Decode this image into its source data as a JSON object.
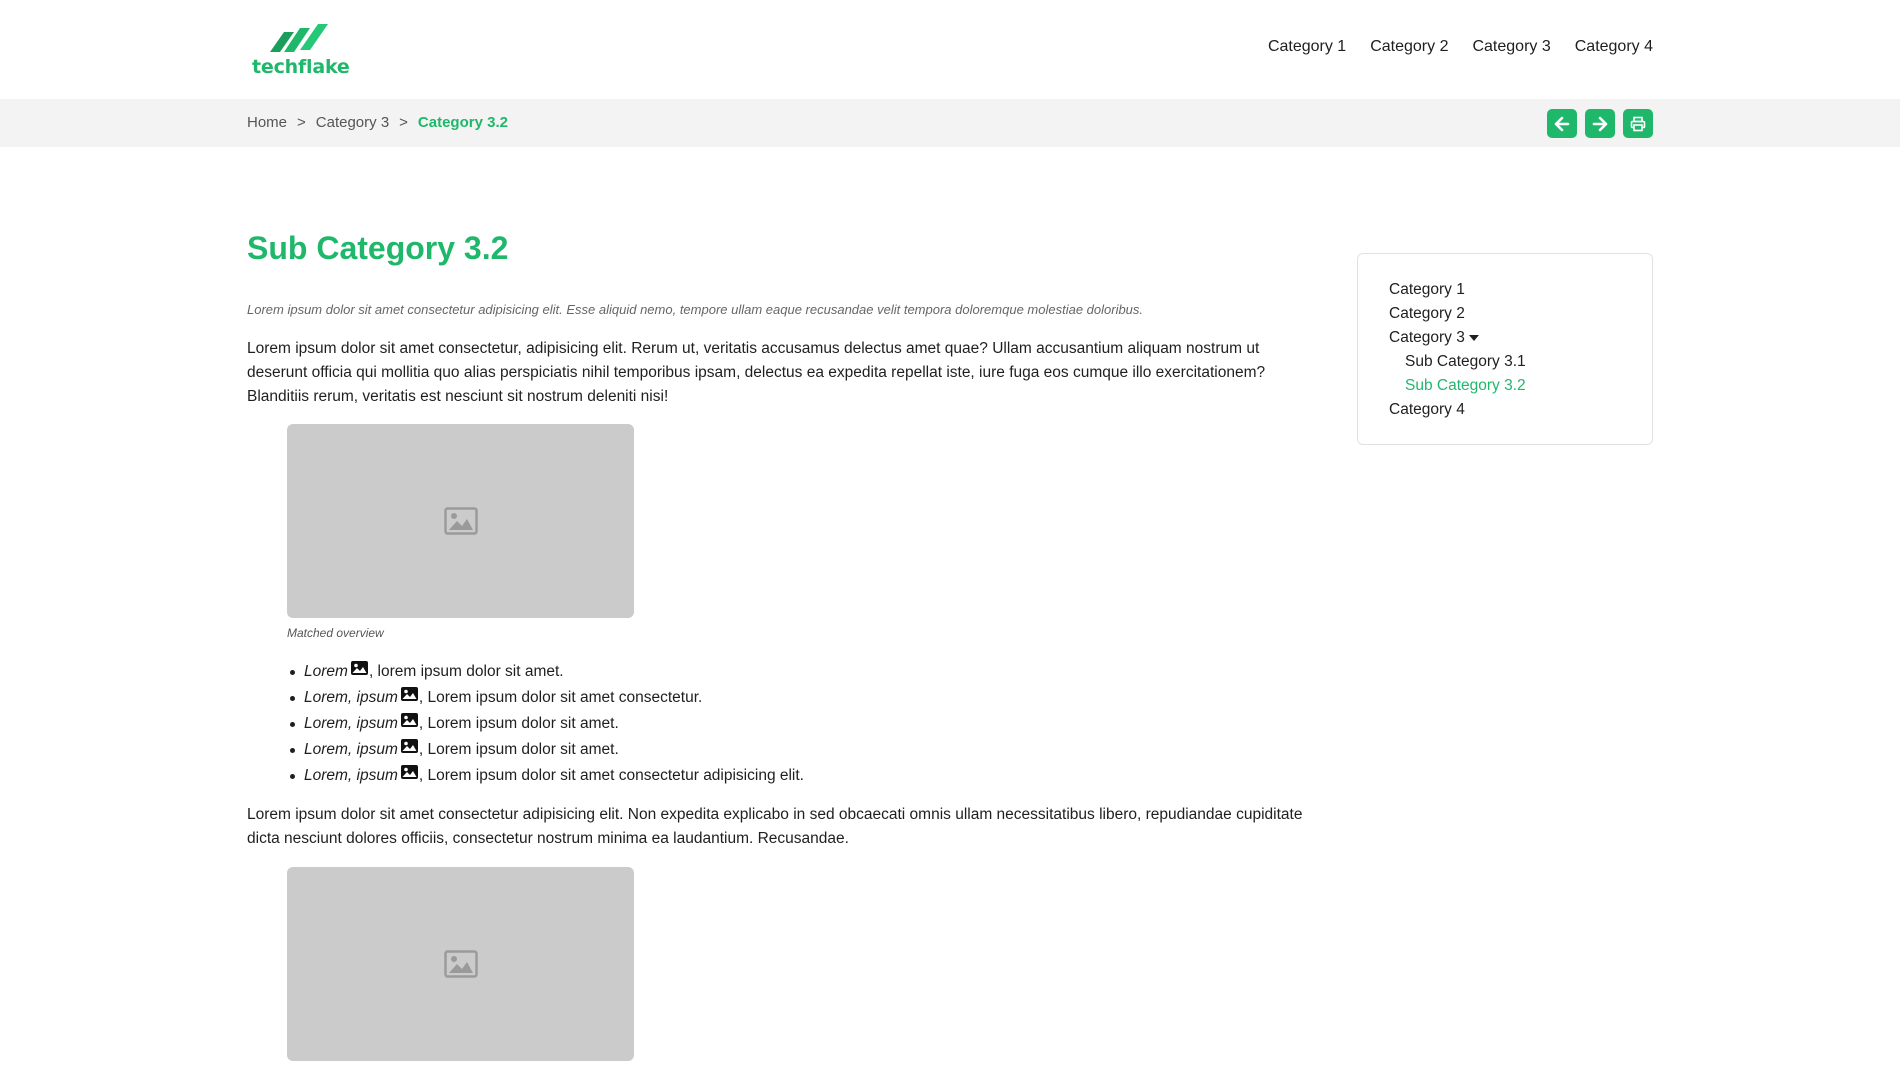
{
  "brand": {
    "name": "techflake",
    "color": "#1fb86b"
  },
  "topnav": {
    "items": [
      "Category 1",
      "Category 2",
      "Category 3",
      "Category 4"
    ]
  },
  "breadcrumb": {
    "items": [
      "Home",
      "Category 3"
    ],
    "separator": ">",
    "current": "Category 3.2"
  },
  "actions": {
    "icons": [
      "arrow-left-icon",
      "arrow-right-icon",
      "print-icon"
    ]
  },
  "content": {
    "title": "Sub Category 3.2",
    "lead": "Lorem ipsum dolor sit amet consectetur adipisicing elit. Esse aliquid nemo, tempore ullam eaque recusandae velit tempora doloremque molestiae doloribus.",
    "paragraph1": "Lorem ipsum dolor sit amet consectetur, adipisicing elit. Rerum ut, veritatis accusamus delectus amet quae? Ullam accusantium aliquam nostrum ut deserunt officia qui mollitia quo alias perspiciatis nihil temporibus ipsam, delectus ea expedita repellat iste, iure fuga eos cumque illo exercitationem? Blanditiis rerum, veritatis est nesciunt sit nostrum deleniti nisi!",
    "figure1_caption": "Matched overview",
    "bullets": [
      {
        "term": "Lorem",
        "text": ", lorem ipsum dolor sit amet."
      },
      {
        "term": "Lorem, ipsum",
        "text": ", Lorem ipsum dolor sit amet consectetur."
      },
      {
        "term": "Lorem, ipsum",
        "text": ", Lorem ipsum dolor sit amet."
      },
      {
        "term": "Lorem, ipsum",
        "text": ", Lorem ipsum dolor sit amet."
      },
      {
        "term": "Lorem, ipsum",
        "text": ", Lorem ipsum dolor sit amet consectetur adipisicing elit."
      }
    ],
    "paragraph2": "Lorem ipsum dolor sit amet consectetur adipisicing elit. Non expedita explicabo in sed obcaecati omnis ullam necessitatibus libero, repudiandae cupiditate dicta nesciunt dolores officiis, consectetur nostrum minima ea laudantium. Recusandae."
  },
  "sidebar": {
    "items": [
      {
        "label": "Category 1"
      },
      {
        "label": "Category 2"
      },
      {
        "label": "Category 3"
      },
      {
        "label": "Sub Category 3.1"
      },
      {
        "label": "Sub Category 3.2"
      },
      {
        "label": "Category 4"
      }
    ]
  }
}
